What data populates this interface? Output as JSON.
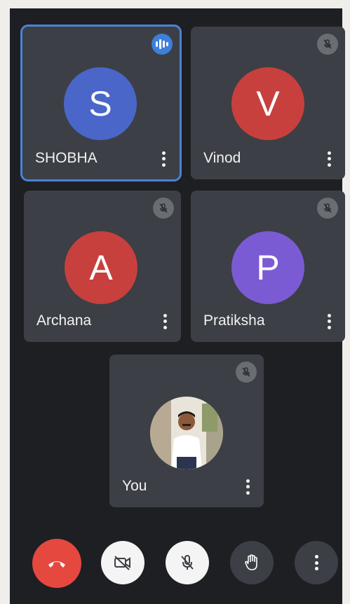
{
  "colors": {
    "screen_bg": "#1d1f22",
    "tile_bg": "#3c3f45",
    "active_outline": "#4a83d6",
    "end_call": "#e5483f",
    "control_light": "#f4f4f4",
    "control_dark": "#3c3f45"
  },
  "participants": [
    {
      "name": "SHOBHA",
      "initial": "S",
      "avatar_color": "#4a66c9",
      "speaking": true,
      "muted": false,
      "icon": "speaking-icon"
    },
    {
      "name": "Vinod",
      "initial": "V",
      "avatar_color": "#c7403d",
      "speaking": false,
      "muted": true,
      "icon": "mic-off-icon"
    },
    {
      "name": "Archana",
      "initial": "A",
      "avatar_color": "#c7403d",
      "speaking": false,
      "muted": true,
      "icon": "mic-off-icon"
    },
    {
      "name": "Pratiksha",
      "initial": "P",
      "avatar_color": "#7b5bd3",
      "speaking": false,
      "muted": true,
      "icon": "mic-off-icon"
    }
  ],
  "self_tile": {
    "name": "You",
    "muted": true,
    "icon": "mic-off-icon",
    "avatar": "user-photo"
  },
  "controls": [
    {
      "name": "end-call-button",
      "icon": "phone-hangup-icon"
    },
    {
      "name": "camera-toggle-button",
      "icon": "video-off-icon"
    },
    {
      "name": "mic-toggle-button",
      "icon": "mic-off-icon"
    },
    {
      "name": "raise-hand-button",
      "icon": "hand-icon"
    },
    {
      "name": "more-options-button",
      "icon": "kebab-icon"
    }
  ]
}
